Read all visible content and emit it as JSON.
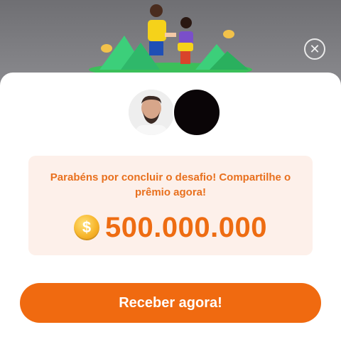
{
  "reward": {
    "message": "Parabéns por concluir o desafio! Compartilhe o prêmio agora!",
    "amount": "500.000.000",
    "coin_symbol": "$"
  },
  "actions": {
    "close_symbol": "✕",
    "receive_label": "Receber agora!"
  },
  "colors": {
    "accent": "#f06a10",
    "amount_text": "#ee6c12",
    "card_background": "#fdf0ea"
  },
  "icons": {
    "close": "close-icon",
    "coin": "coin-icon",
    "avatar_1": "user-avatar-photo",
    "avatar_2": "user-avatar-black"
  }
}
